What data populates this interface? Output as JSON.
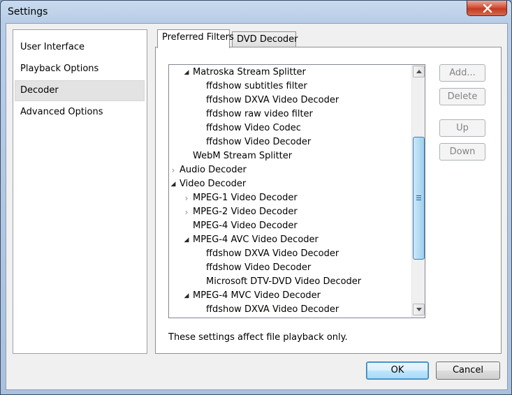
{
  "window": {
    "title": "Settings"
  },
  "sidebar": {
    "items": [
      {
        "label": "User Interface",
        "selected": false
      },
      {
        "label": "Playback Options",
        "selected": false
      },
      {
        "label": "Decoder",
        "selected": true
      },
      {
        "label": "Advanced Options",
        "selected": false
      }
    ]
  },
  "tabs": [
    {
      "label": "Preferred Filters",
      "active": true
    },
    {
      "label": "DVD Decoder",
      "active": false
    }
  ],
  "tree": {
    "rows": [
      {
        "label": "Matroska Stream Splitter",
        "level": 1,
        "state": "expanded"
      },
      {
        "label": "ffdshow subtitles filter",
        "level": 2,
        "state": "leaf"
      },
      {
        "label": "ffdshow DXVA Video Decoder",
        "level": 2,
        "state": "leaf"
      },
      {
        "label": "ffdshow raw video filter",
        "level": 2,
        "state": "leaf"
      },
      {
        "label": "ffdshow Video Codec",
        "level": 2,
        "state": "leaf"
      },
      {
        "label": "ffdshow Video Decoder",
        "level": 2,
        "state": "leaf"
      },
      {
        "label": "WebM Stream Splitter",
        "level": 1,
        "state": "leaf"
      },
      {
        "label": "Audio Decoder",
        "level": 0,
        "state": "collapsed"
      },
      {
        "label": "Video Decoder",
        "level": 0,
        "state": "expanded"
      },
      {
        "label": "MPEG-1 Video Decoder",
        "level": 1,
        "state": "collapsed"
      },
      {
        "label": "MPEG-2 Video Decoder",
        "level": 1,
        "state": "collapsed"
      },
      {
        "label": "MPEG-4 Video Decoder",
        "level": 1,
        "state": "leaf"
      },
      {
        "label": "MPEG-4 AVC Video Decoder",
        "level": 1,
        "state": "expanded"
      },
      {
        "label": "ffdshow DXVA Video Decoder",
        "level": 2,
        "state": "leaf"
      },
      {
        "label": "ffdshow Video Decoder",
        "level": 2,
        "state": "leaf"
      },
      {
        "label": "Microsoft DTV-DVD Video Decoder",
        "level": 2,
        "state": "leaf"
      },
      {
        "label": "MPEG-4 MVC Video Decoder",
        "level": 1,
        "state": "expanded"
      },
      {
        "label": "ffdshow DXVA Video Decoder",
        "level": 2,
        "state": "leaf"
      }
    ]
  },
  "actions": {
    "add": "Add...",
    "delete": "Delete",
    "up": "Up",
    "down": "Down"
  },
  "note": "These settings affect file playback only.",
  "footer": {
    "ok": "OK",
    "cancel": "Cancel"
  }
}
